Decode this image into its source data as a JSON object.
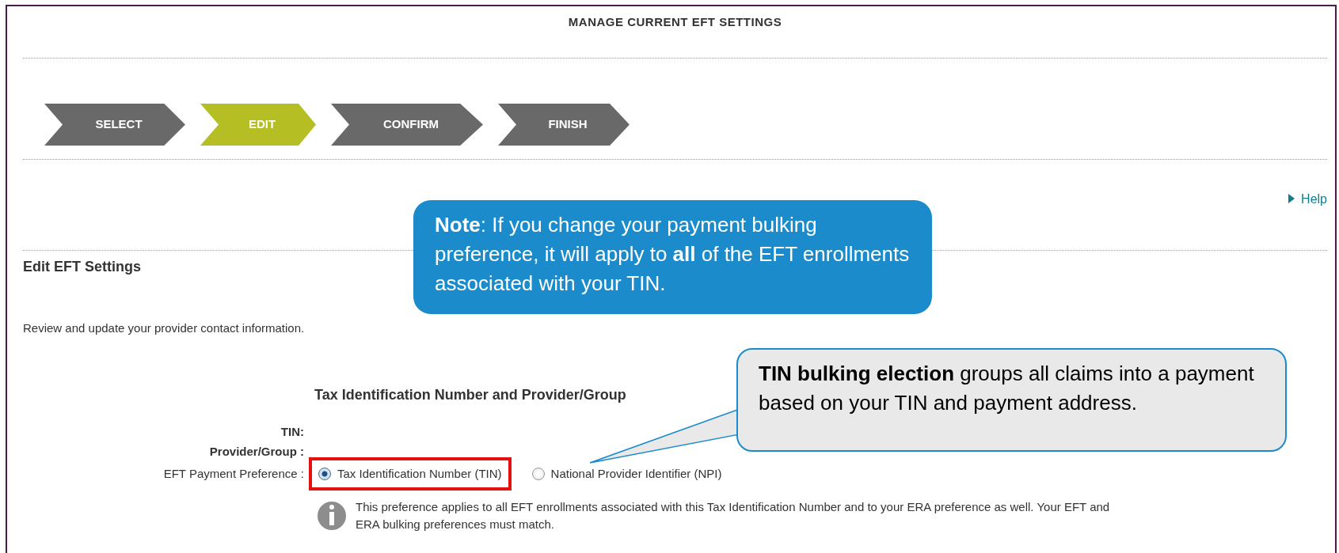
{
  "title": "MANAGE CURRENT EFT SETTINGS",
  "steps": [
    {
      "label": "SELECT",
      "selected": false
    },
    {
      "label": "EDIT",
      "selected": true
    },
    {
      "label": "CONFIRM",
      "selected": false
    },
    {
      "label": "FINISH",
      "selected": false
    }
  ],
  "help_link": "Help",
  "section_heading": "Edit EFT Settings",
  "intro": "Review and update your provider contact information.",
  "form": {
    "title": "Tax Identification Number and Provider/Group",
    "fields": [
      {
        "label": "TIN:"
      },
      {
        "label": "Provider/Group :"
      },
      {
        "label": "EFT Payment Preference :",
        "options": [
          {
            "label": "Tax Identification Number (TIN)",
            "selected": true,
            "highlighted": true
          },
          {
            "label": "National Provider Identifier (NPI)",
            "selected": false,
            "highlighted": false
          }
        ]
      }
    ],
    "info": "This preference applies to all EFT enrollments associated with this Tax Identification Number and to your ERA preference as well. Your EFT and ERA bulking preferences must match."
  },
  "callouts": [
    {
      "kind": "note",
      "text": "**Note**: If you change your payment bulking preference, it will apply to **all** of the EFT enrollments associated with your TIN."
    },
    {
      "kind": "pointer",
      "text": "**TIN bulking election** groups all claims into a payment based on your TIN and payment address."
    }
  ]
}
